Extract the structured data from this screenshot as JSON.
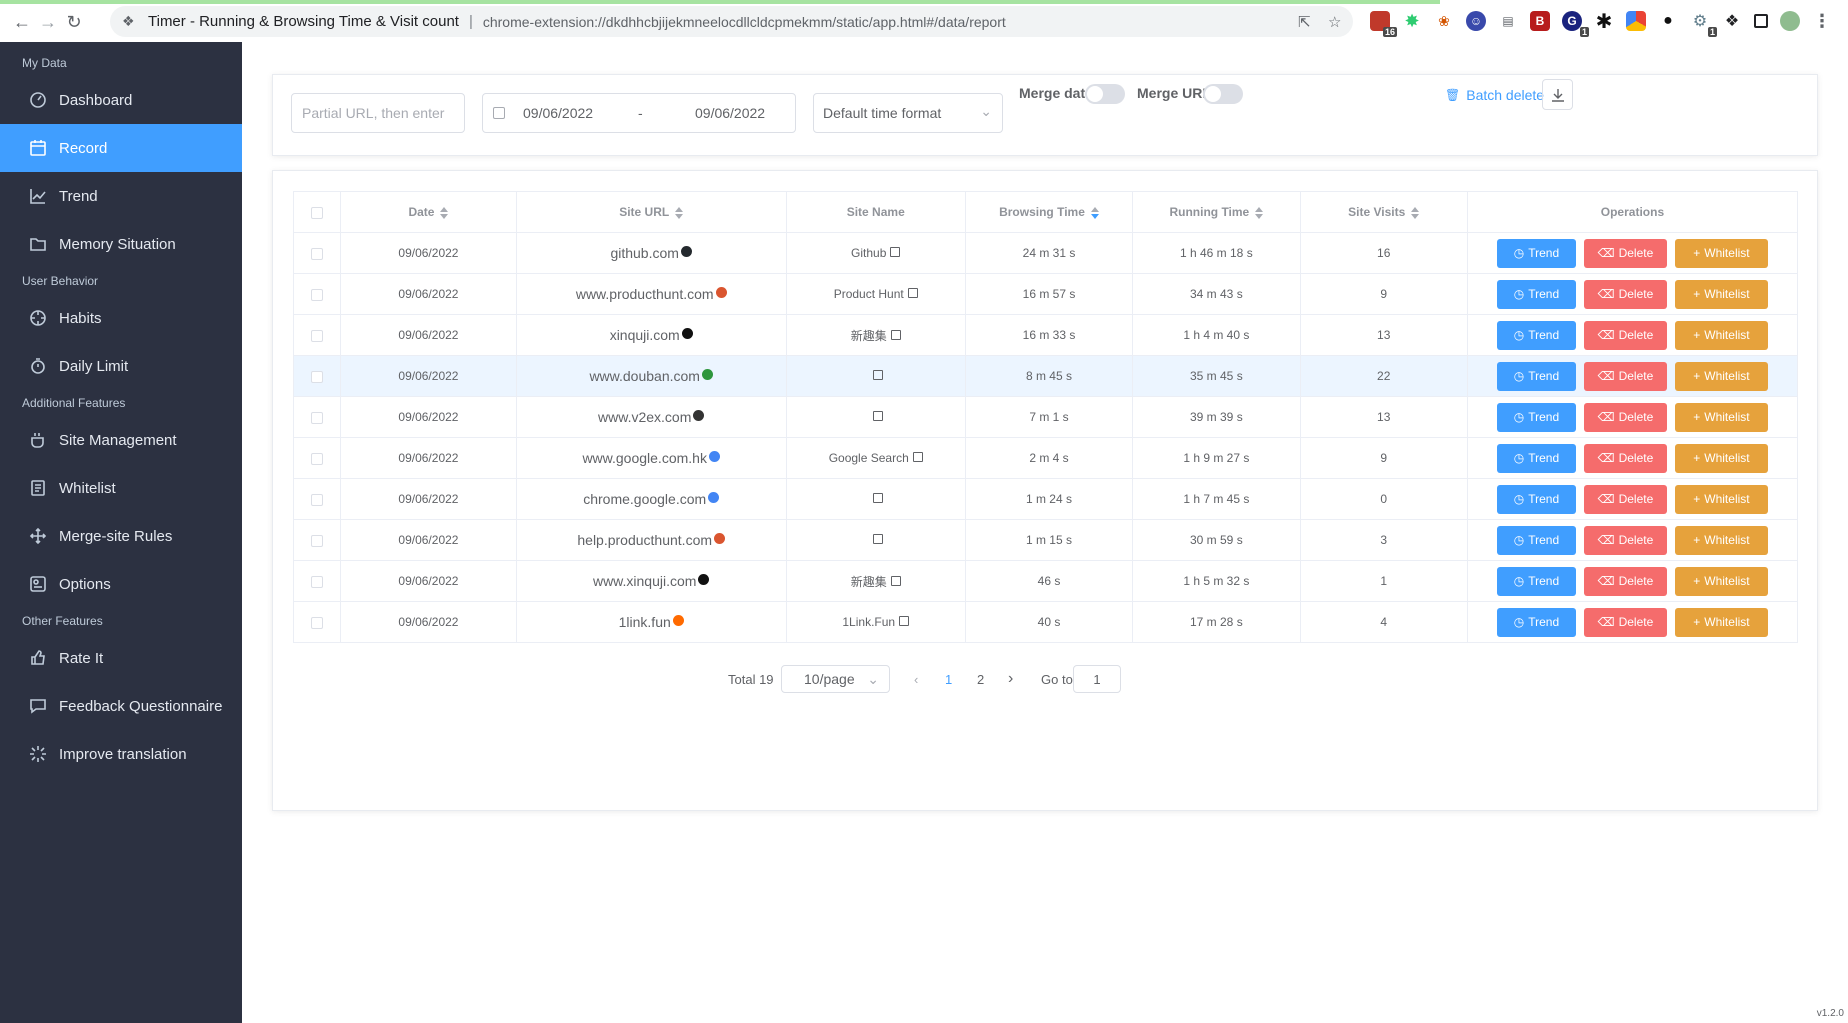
{
  "browser": {
    "tab_title": "Timer - Running & Browsing Time & Visit count",
    "url": "chrome-extension://dkdhhcbjijekmneelocdllcldcpmekmm/static/app.html#/data/report",
    "ext_badges": [
      "16",
      "1",
      "1"
    ]
  },
  "sidebar": {
    "groups": [
      {
        "label": "My Data",
        "items": [
          "Dashboard",
          "Record",
          "Trend",
          "Memory Situation"
        ]
      },
      {
        "label": "User Behavior",
        "items": [
          "Habits",
          "Daily Limit"
        ]
      },
      {
        "label": "Additional Features",
        "items": [
          "Site Management",
          "Whitelist",
          "Merge-site Rules",
          "Options"
        ]
      },
      {
        "label": "Other Features",
        "items": [
          "Rate It",
          "Feedback Questionnaire",
          "Improve translation"
        ]
      }
    ],
    "active": "Record"
  },
  "filter": {
    "url_placeholder": "Partial URL, then enter",
    "date_start": "09/06/2022",
    "date_sep": "-",
    "date_end": "09/06/2022",
    "time_format": "Default time format",
    "merge_date_label": "Merge date",
    "merge_url_label": "Merge URL",
    "batch_delete_label": "Batch delete"
  },
  "table": {
    "headers": [
      "Date",
      "Site URL",
      "Site Name",
      "Browsing Time",
      "Running Time",
      "Site Visits",
      "Operations"
    ],
    "rows": [
      {
        "date": "09/06/2022",
        "url": "github.com",
        "name": "Github",
        "browsing": "24 m 31 s",
        "running": "1 h 46 m 18 s",
        "visits": "16"
      },
      {
        "date": "09/06/2022",
        "url": "www.producthunt.com",
        "name": "Product Hunt",
        "browsing": "16 m 57 s",
        "running": "34 m 43 s",
        "visits": "9"
      },
      {
        "date": "09/06/2022",
        "url": "xinquji.com",
        "name": "新趣集",
        "browsing": "16 m 33 s",
        "running": "1 h 4 m 40 s",
        "visits": "13"
      },
      {
        "date": "09/06/2022",
        "url": "www.douban.com",
        "name": "",
        "browsing": "8 m 45 s",
        "running": "35 m 45 s",
        "visits": "22"
      },
      {
        "date": "09/06/2022",
        "url": "www.v2ex.com",
        "name": "",
        "browsing": "7 m 1 s",
        "running": "39 m 39 s",
        "visits": "13"
      },
      {
        "date": "09/06/2022",
        "url": "www.google.com.hk",
        "name": "Google Search",
        "browsing": "2 m 4 s",
        "running": "1 h 9 m 27 s",
        "visits": "9"
      },
      {
        "date": "09/06/2022",
        "url": "chrome.google.com",
        "name": "",
        "browsing": "1 m 24 s",
        "running": "1 h 7 m 45 s",
        "visits": "0"
      },
      {
        "date": "09/06/2022",
        "url": "help.producthunt.com",
        "name": "",
        "browsing": "1 m 15 s",
        "running": "30 m 59 s",
        "visits": "3"
      },
      {
        "date": "09/06/2022",
        "url": "www.xinquji.com",
        "name": "新趣集",
        "browsing": "46 s",
        "running": "1 h 5 m 32 s",
        "visits": "1"
      },
      {
        "date": "09/06/2022",
        "url": "1link.fun",
        "name": "1Link.Fun",
        "browsing": "40 s",
        "running": "17 m 28 s",
        "visits": "4"
      }
    ],
    "favicon_colors": [
      "#24292e",
      "#da552f",
      "#111111",
      "#2e963d",
      "#333333",
      "#4285f4",
      "#4285f4",
      "#da552f",
      "#111111",
      "#ff6a00"
    ],
    "ops": {
      "trend": "Trend",
      "delete": "Delete",
      "whitelist": "Whitelist"
    }
  },
  "pager": {
    "total": "Total 19",
    "page_size": "10/page",
    "pages": [
      "1",
      "2"
    ],
    "current": "1",
    "goto_label": "Go to",
    "goto_value": "1"
  },
  "version": "v1.2.0",
  "colors": {
    "primary": "#409eff",
    "danger": "#f56c6c",
    "warning": "#e6a23c",
    "sidebar": "#2c3141"
  }
}
